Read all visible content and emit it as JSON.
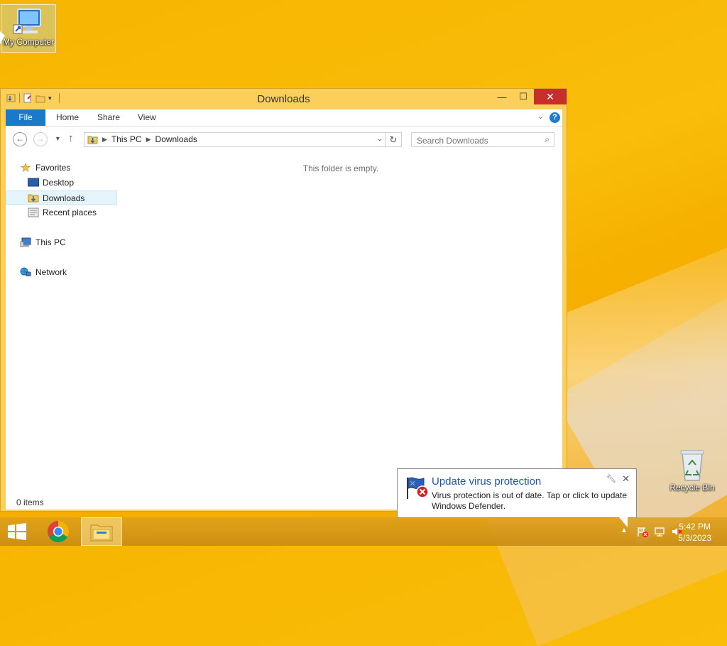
{
  "desktop": {
    "icons": [
      {
        "label": "My Computer"
      },
      {
        "label": "Recycle Bin"
      }
    ]
  },
  "window": {
    "title": "Downloads",
    "controls": {
      "minimize": "—",
      "maximize": "☐",
      "close": "✕"
    },
    "ribbon": {
      "tabs": [
        "File",
        "Home",
        "Share",
        "View"
      ],
      "help": "?"
    },
    "address": {
      "crumbs": [
        "This PC",
        "Downloads"
      ]
    },
    "search": {
      "placeholder": "Search Downloads"
    },
    "nav_pane": {
      "favorites": "Favorites",
      "desktop": "Desktop",
      "downloads": "Downloads",
      "recent": "Recent places",
      "this_pc": "This PC",
      "network": "Network"
    },
    "empty_text": "This folder is empty.",
    "status": "0 items"
  },
  "notification": {
    "title": "Update virus protection",
    "message": "Virus protection is out of date. Tap or click to update Windows Defender."
  },
  "taskbar": {
    "clock_time": "5:42 PM",
    "clock_date": "5/3/2023"
  },
  "colors": {
    "accent": "#1979ca",
    "window_frame": "#fbcf5a",
    "close_button": "#c7302a",
    "wallpaper": "#f7b500"
  }
}
